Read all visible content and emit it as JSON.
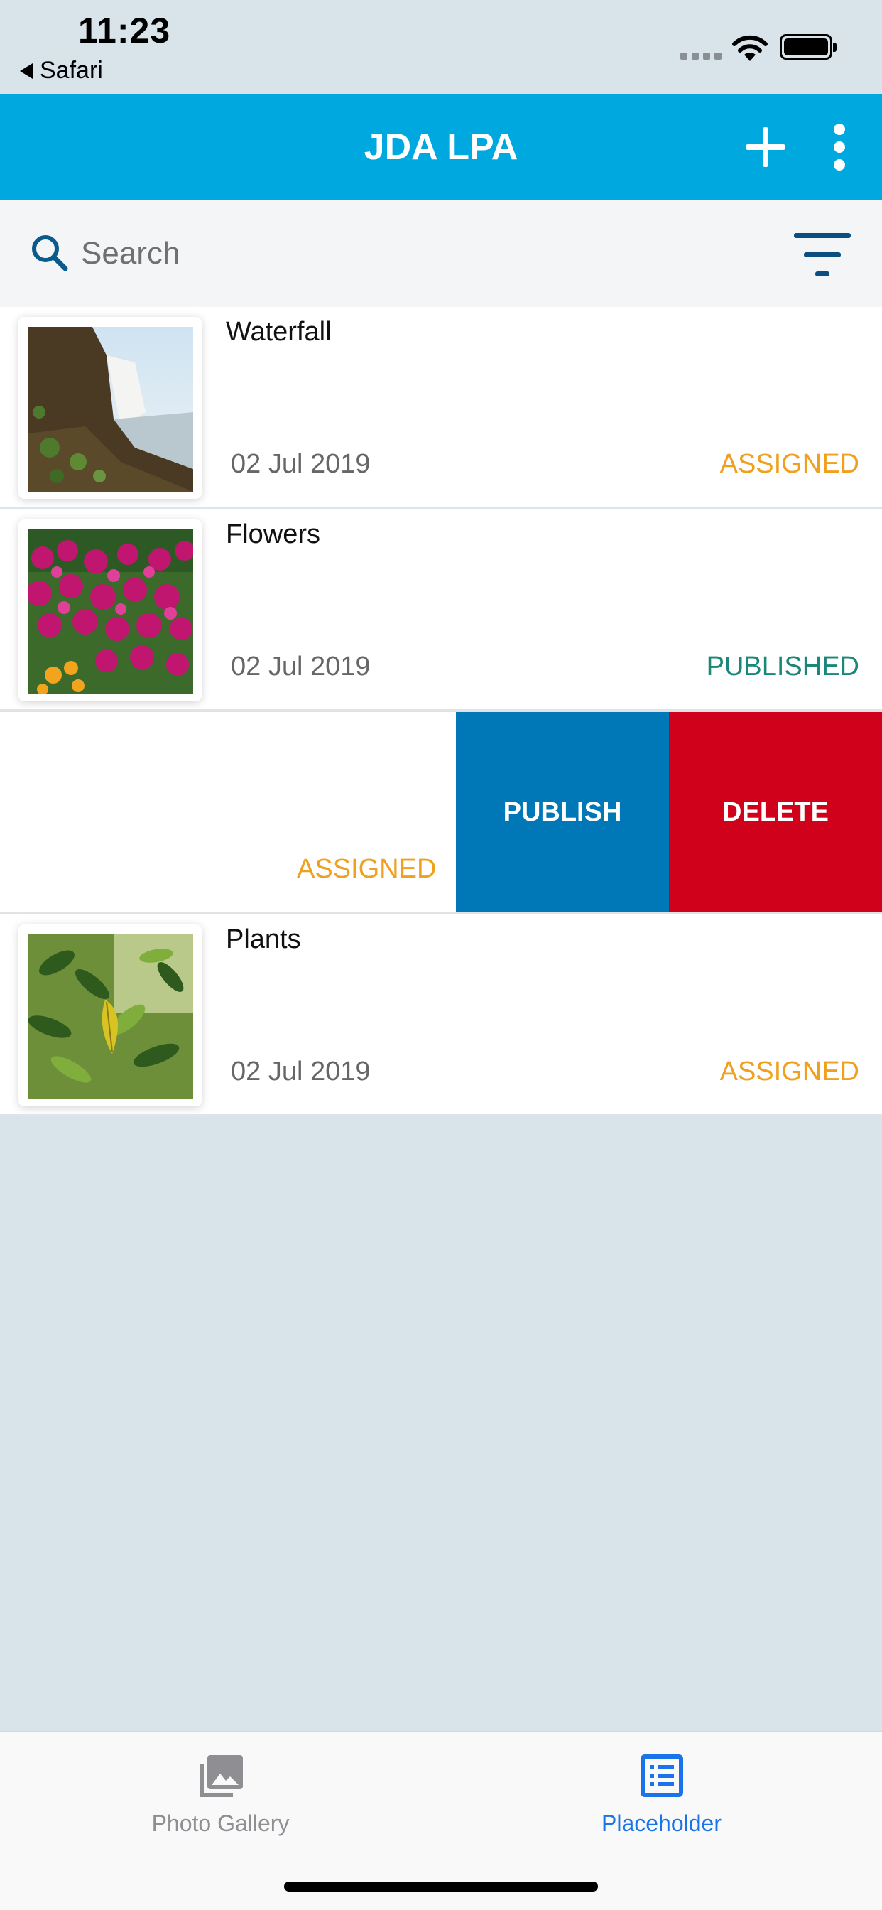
{
  "status_bar": {
    "time": "11:23",
    "back_label": "Safari"
  },
  "app_bar": {
    "title": "JDA LPA",
    "add_icon": "plus-icon",
    "more_icon": "more-vertical-icon"
  },
  "search": {
    "placeholder": "Search",
    "value": "",
    "icon": "search-icon",
    "filter_icon": "filter-icon"
  },
  "list": {
    "items": [
      {
        "title": "Waterfall",
        "date": "02 Jul 2019",
        "status": "ASSIGNED",
        "status_color": "#f0a020"
      },
      {
        "title": "Flowers",
        "date": "02 Jul 2019",
        "status": "PUBLISHED",
        "status_color": "#1b8778"
      },
      {
        "title": "Plants",
        "date": "02 Jul 2019",
        "status": "ASSIGNED",
        "status_color": "#f0a020"
      }
    ],
    "swiped_item": {
      "status": "ASSIGNED",
      "publish_label": "PUBLISH",
      "delete_label": "DELETE"
    }
  },
  "tabs": [
    {
      "label": "Photo Gallery",
      "icon": "photo-gallery-icon",
      "active": false
    },
    {
      "label": "Placeholder",
      "icon": "list-icon",
      "active": true
    }
  ],
  "colors": {
    "accent": "#00a8e0",
    "publish": "#0077b6",
    "delete": "#d0021b",
    "assigned": "#f0a020",
    "published": "#1b8778",
    "tab_active": "#1a73e8",
    "tab_inactive": "#8e8e93"
  }
}
